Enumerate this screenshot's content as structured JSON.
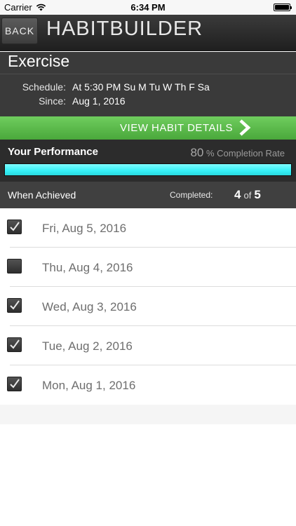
{
  "status_bar": {
    "carrier": "Carrier",
    "time": "6:34 PM"
  },
  "nav": {
    "back_label": "BACK",
    "title": "HABITBUILDER"
  },
  "habit": {
    "name": "Exercise",
    "schedule_label": "Schedule:",
    "schedule_value": "At 5:30 PM Su M Tu W Th F Sa",
    "since_label": "Since:",
    "since_value": "Aug 1, 2016"
  },
  "details_button": {
    "label": "VIEW HABIT DETAILS"
  },
  "performance": {
    "title": "Your Performance",
    "rate_value": "80",
    "rate_suffix": "% Completion Rate",
    "progress_fraction": 1.0
  },
  "achieved": {
    "label": "When Achieved",
    "completed_label": "Completed:",
    "completed": "4",
    "of": "of",
    "total": "5"
  },
  "days": [
    {
      "label": "Fri, Aug 5, 2016",
      "checked": true
    },
    {
      "label": "Thu, Aug 4, 2016",
      "checked": false
    },
    {
      "label": "Wed, Aug 3, 2016",
      "checked": true
    },
    {
      "label": "Tue, Aug 2, 2016",
      "checked": true
    },
    {
      "label": "Mon, Aug 1, 2016",
      "checked": true
    }
  ],
  "colors": {
    "accent_green": "#5cbd4b",
    "progress_cyan": "#35f0f6",
    "nav_dark": "#2c2c2c"
  }
}
